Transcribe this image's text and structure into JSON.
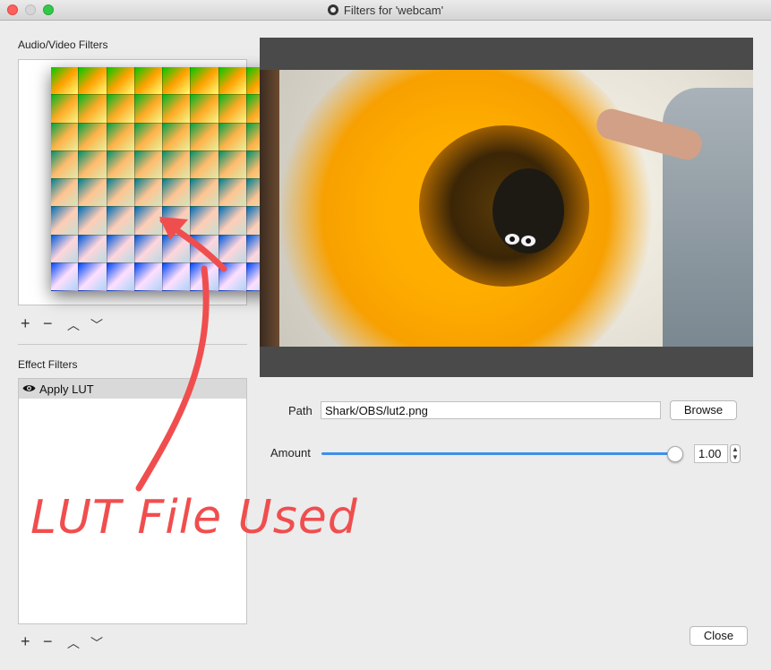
{
  "window": {
    "title": "Filters for 'webcam'"
  },
  "audio_video": {
    "heading": "Audio/Video Filters"
  },
  "toolbar": {
    "add": "+",
    "remove": "−",
    "up": "︿",
    "down": "﹀"
  },
  "effect": {
    "heading": "Effect Filters",
    "items": [
      {
        "label": "Apply LUT",
        "visible_icon": "eye-icon"
      }
    ]
  },
  "settings": {
    "path_label": "Path",
    "path_value": "Shark/OBS/lut2.png",
    "browse_label": "Browse",
    "amount_label": "Amount",
    "amount_value": "1.00",
    "amount_fraction": 1.0
  },
  "footer": {
    "close_label": "Close"
  },
  "annotation": {
    "text": "LUT File Used",
    "color": "#f04e4e"
  },
  "colors": {
    "accent": "#3f8fe8",
    "selection": "#d9d9d9",
    "preview_bg": "#4a4a4a"
  }
}
